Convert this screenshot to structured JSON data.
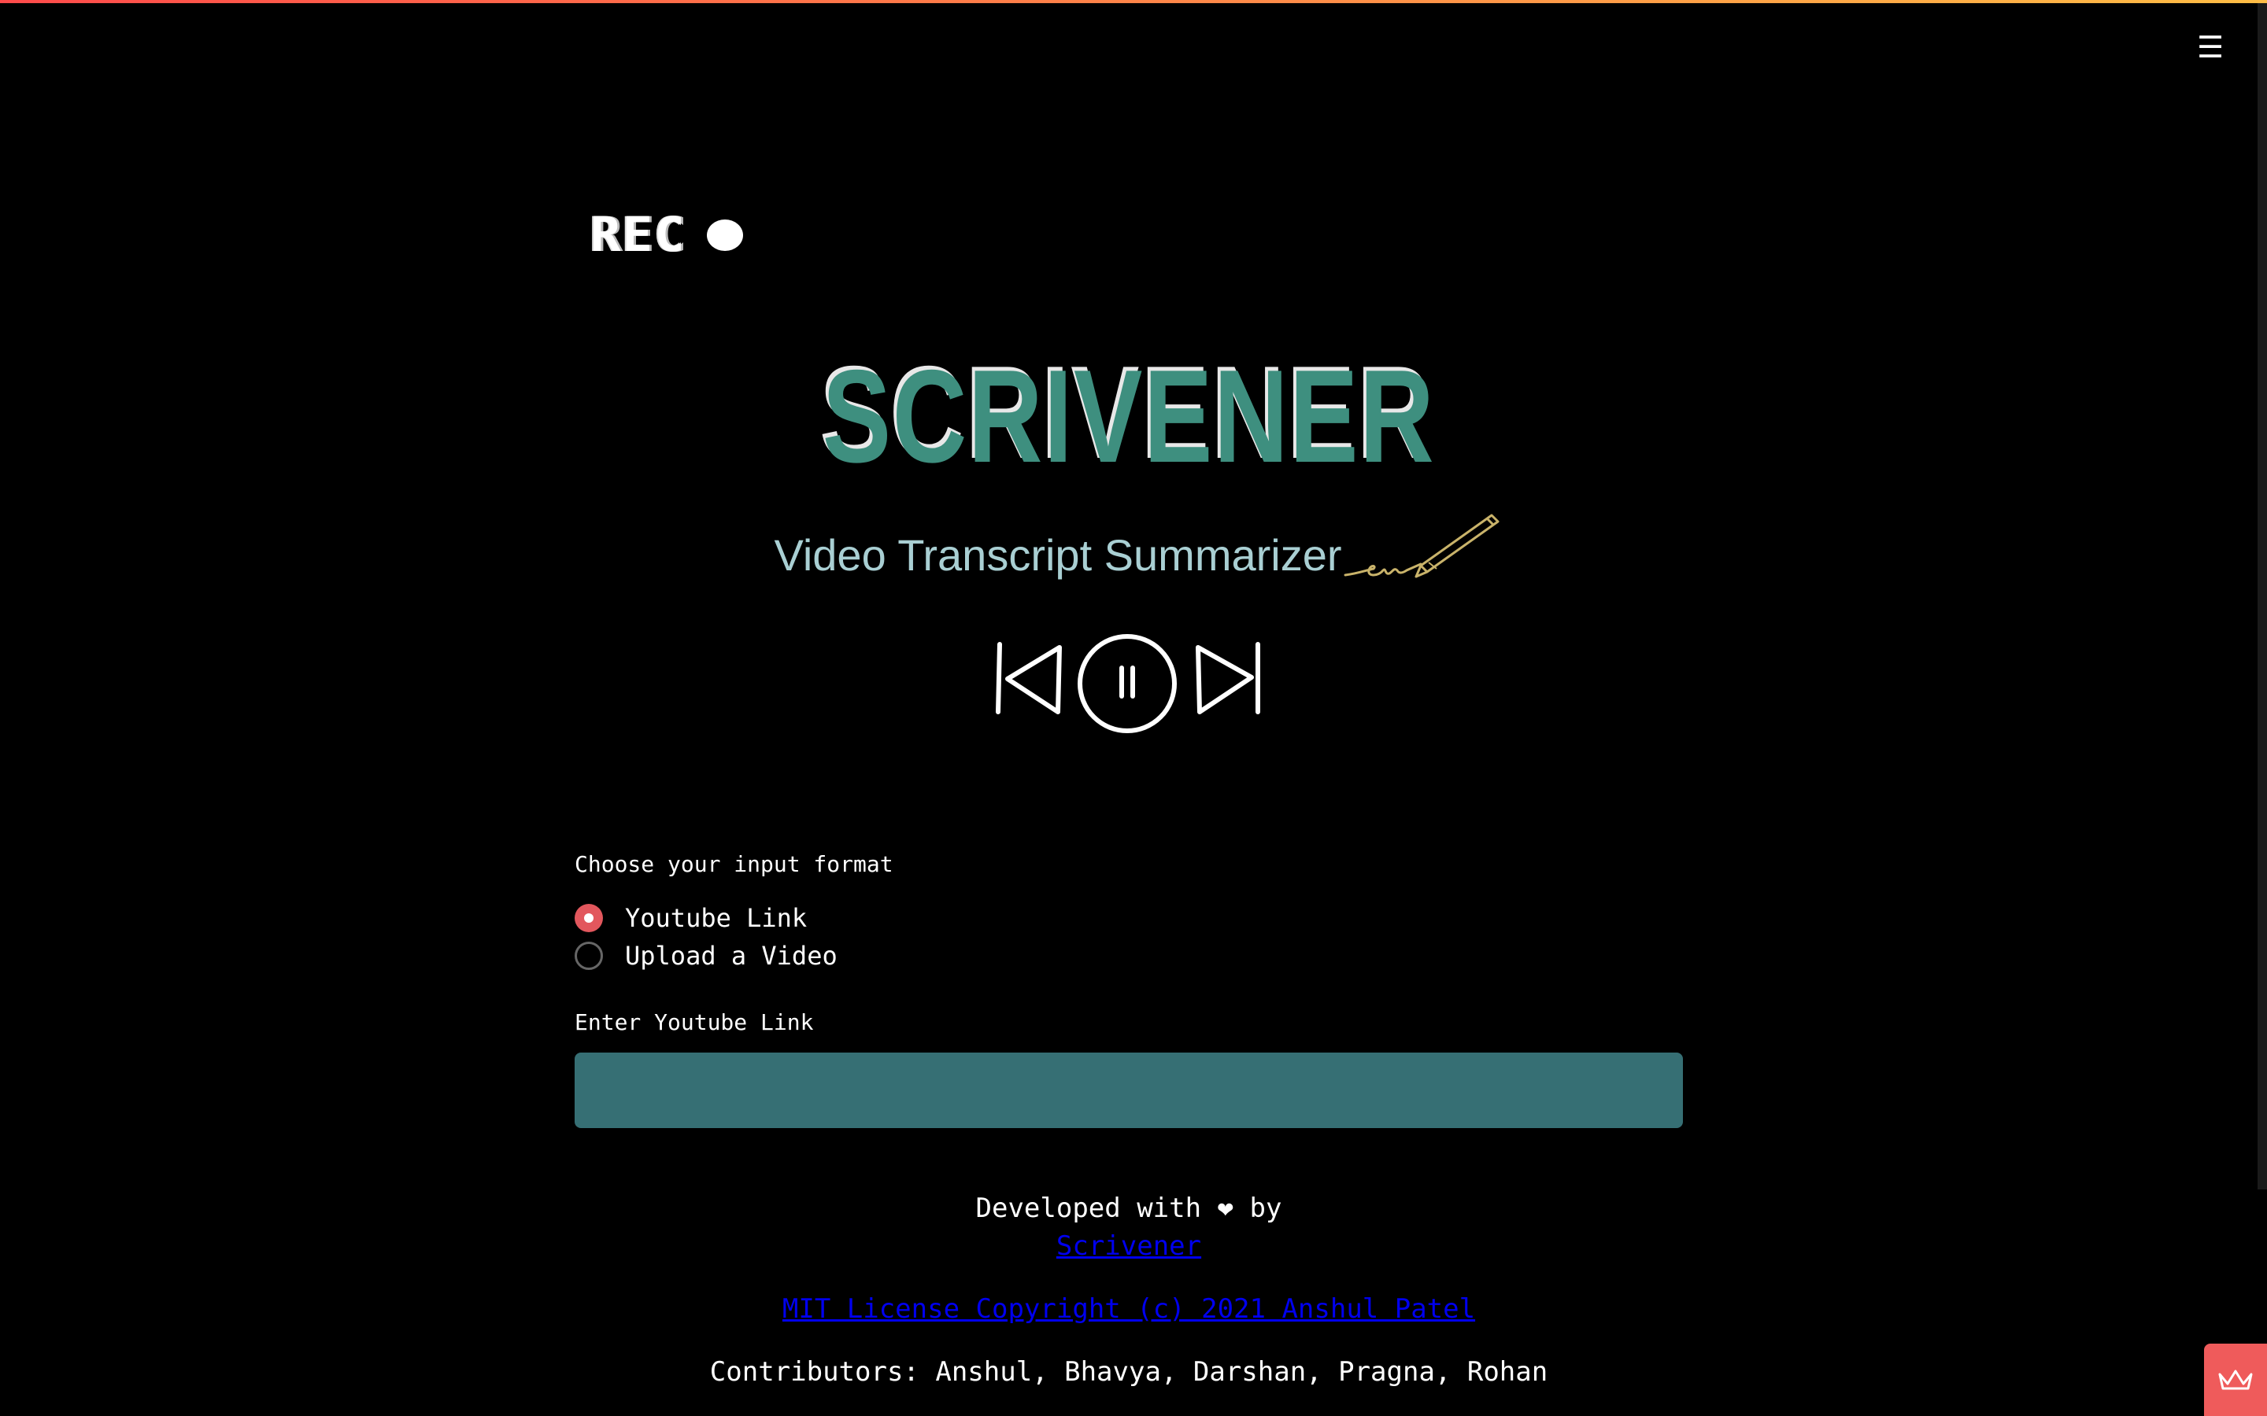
{
  "header": {
    "menu_icon": "hamburger-menu-icon"
  },
  "hero": {
    "rec_label": "REC",
    "title": "SCRIVENER",
    "subtitle": "Video Transcript Summarizer"
  },
  "form": {
    "format_label": "Choose your input format",
    "options": [
      {
        "label": "Youtube Link",
        "selected": true
      },
      {
        "label": "Upload a Video",
        "selected": false
      }
    ],
    "link_label": "Enter Youtube Link",
    "link_value": ""
  },
  "footer": {
    "developed_prefix": "Developed with",
    "heart": "❤",
    "developed_suffix": "by",
    "dev_link": "Scrivener",
    "license_link": "MIT License Copyright (c) 2021 Anshul Patel",
    "contributors": "Contributors: Anshul, Bhavya, Darshan, Pragna, Rohan"
  },
  "colors": {
    "accent_bar": "#ff4b4b",
    "title": "#3e8f7f",
    "subtitle": "#a9cfd3",
    "input_bg": "#366f74",
    "radio_on": "#e2575d",
    "badge": "#ef5b5b"
  }
}
